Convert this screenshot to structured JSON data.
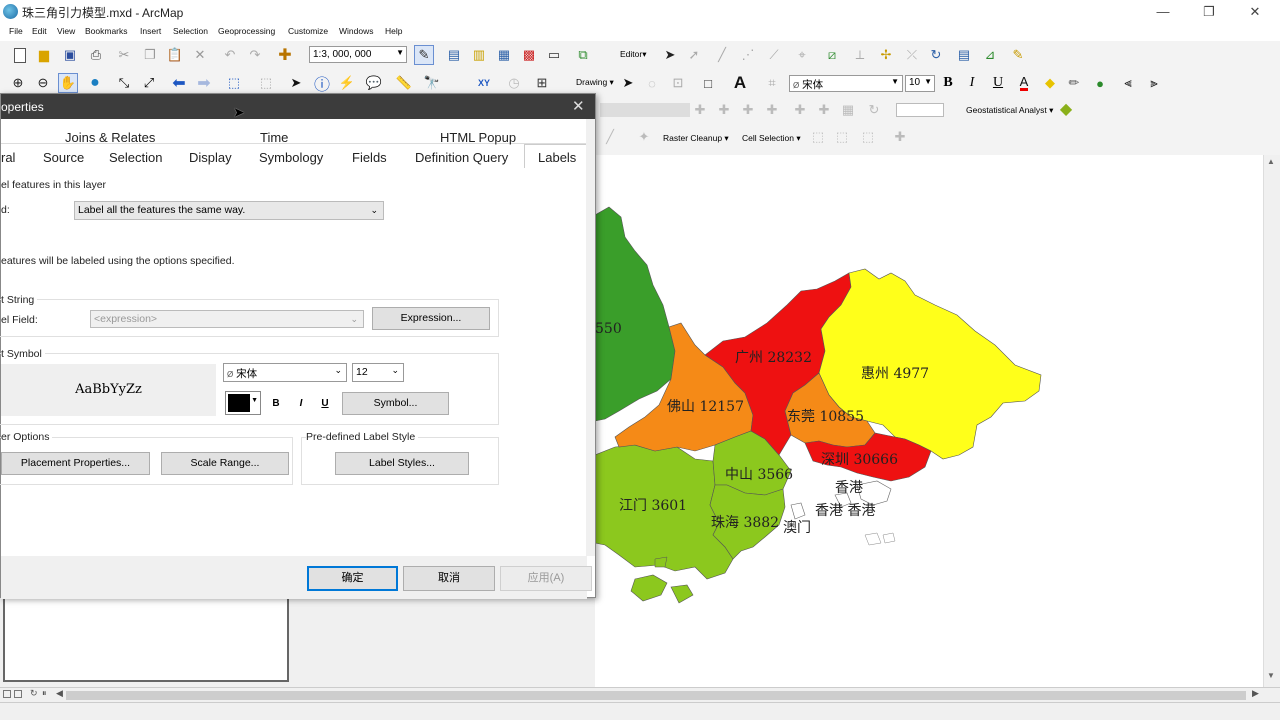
{
  "window": {
    "title": "珠三角引力模型.mxd - ArcMap",
    "minimize": "—",
    "restore": "❐",
    "close": "✕"
  },
  "menu": [
    "File",
    "Edit",
    "View",
    "Bookmarks",
    "Insert",
    "Selection",
    "Geoprocessing",
    "Customize",
    "Windows",
    "Help"
  ],
  "toolbar": {
    "scale": "1:3, 000, 000",
    "editor": "Editor▾",
    "drawing": "Drawing ▾",
    "font_name": "宋体",
    "font_size": "10",
    "geostatistical": "Geostatistical Analyst ▾",
    "raster_cleanup": "Raster Cleanup ▾",
    "cell_selection": "Cell Selection ▾"
  },
  "dialog": {
    "title": "operties",
    "close": "✕",
    "tabs_row1": [
      "Joins & Relates",
      "Time",
      "HTML Popup"
    ],
    "tabs_row2": [
      "ral",
      "Source",
      "Selection",
      "Display",
      "Symbology",
      "Fields",
      "Definition Query",
      "Labels"
    ],
    "label_features_checkbox": "el features in this layer",
    "method_label": "d:",
    "method_value": "Label all the features the same way.",
    "info_text": "eatures will be labeled using the options specified.",
    "text_string_group": "t String",
    "label_field_label": "el Field:",
    "label_field_value": "<expression>",
    "expression_button": "Expression...",
    "text_symbol_group": "t Symbol",
    "preview_text": "AaBbYyZz",
    "symbol_font": "宋体",
    "symbol_size": "12",
    "bold": "B",
    "italic": "I",
    "underline": "U",
    "symbol_button": "Symbol...",
    "other_options_group": "er Options",
    "placement_button": "Placement Properties...",
    "scale_range_button": "Scale Range...",
    "predefined_group": "Pre-defined Label Style",
    "label_styles_button": "Label Styles...",
    "ok": "确定",
    "cancel": "取消",
    "apply": "应用(A)"
  },
  "map_labels": [
    {
      "name": "guangzhou",
      "text": "广州 28232"
    },
    {
      "name": "huizhou",
      "text": "惠州 4977"
    },
    {
      "name": "foshan",
      "text": "佛山 12157"
    },
    {
      "name": "dongguan",
      "text": "东莞 10855"
    },
    {
      "name": "shenzhen",
      "text": "深圳 30666"
    },
    {
      "name": "zhongshan",
      "text": "中山 3566"
    },
    {
      "name": "jiangmen",
      "text": "江门 3601"
    },
    {
      "name": "zhuhai",
      "text": "珠海 3882"
    },
    {
      "name": "macau",
      "text": "澳门"
    },
    {
      "name": "hk1",
      "text": "香港"
    },
    {
      "name": "hk2",
      "text": "香港 香港"
    },
    {
      "name": "zhaoqing",
      "text": "550"
    }
  ],
  "colors": {
    "red": "#ee1111",
    "orange": "#f58a17",
    "yellow": "#ffff1a",
    "green_dark": "#3a9e2a",
    "green_light": "#8cc81e"
  }
}
